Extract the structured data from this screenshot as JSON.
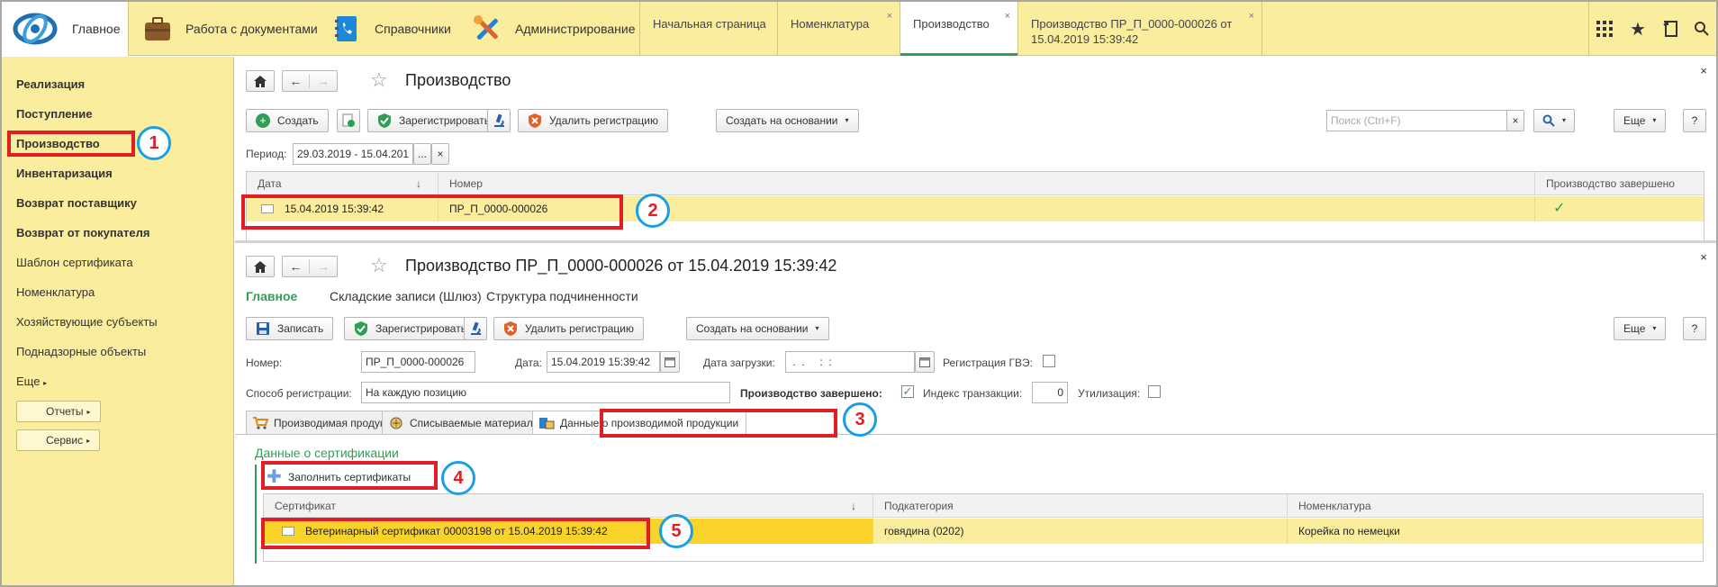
{
  "topbar": {
    "sections": [
      {
        "label": "Главное",
        "icon": "logo-icon"
      },
      {
        "label": "Работа с документами",
        "icon": "briefcase-icon"
      },
      {
        "label": "Справочники",
        "icon": "phonebook-icon"
      },
      {
        "label": "Администрирование",
        "icon": "tools-icon"
      }
    ],
    "tabs": [
      {
        "label": "Начальная страница"
      },
      {
        "label": "Номенклатура",
        "close": "×"
      },
      {
        "label": "Производство",
        "close": "×"
      },
      {
        "label": "Производство ПР_П_0000-000026 от 15.04.2019 15:39:42",
        "close": "×"
      }
    ],
    "right_icons": [
      "apps-grid-icon",
      "star-icon",
      "history-icon",
      "search-icon"
    ]
  },
  "sidebar": {
    "items": [
      {
        "label": "Реализация",
        "bold": true
      },
      {
        "label": "Поступление",
        "bold": true
      },
      {
        "label": "Производство",
        "bold": true
      },
      {
        "label": "Инвентаризация",
        "bold": true
      },
      {
        "label": "Возврат поставщику",
        "bold": true
      },
      {
        "label": "Возврат от покупателя",
        "bold": true
      },
      {
        "label": "Шаблон сертификата",
        "bold": false
      },
      {
        "label": "Номенклатура",
        "bold": false
      },
      {
        "label": "Хозяйствующие субъекты",
        "bold": false
      },
      {
        "label": "Поднадзорные объекты",
        "bold": false
      },
      {
        "label": "Еще",
        "bold": false
      }
    ],
    "reports_label": "Отчеты",
    "service_label": "Сервис"
  },
  "list_form": {
    "title": "Производство",
    "close": "×",
    "toolbar": {
      "create": "Создать",
      "register": "Зарегистрировать",
      "delete_registration": "Удалить регистрацию",
      "create_based_on": "Создать на основании",
      "search_placeholder": "Поиск (Ctrl+F)",
      "search_clear": "×",
      "more": "Еще",
      "help": "?"
    },
    "period_label": "Период:",
    "period_value": "29.03.2019 - 15.04.201",
    "period_pick": "...",
    "period_clear": "×",
    "columns": [
      "Дата",
      "Номер",
      "Производство завершено"
    ],
    "sort_arrow": "↓",
    "rows": [
      {
        "date": "15.04.2019 15:39:42",
        "number": "ПР_П_0000-000026",
        "completed": "✓"
      }
    ]
  },
  "doc_form": {
    "title": "Производство ПР_П_0000-000026 от 15.04.2019 15:39:42",
    "close": "×",
    "nav": [
      "Главное",
      "Складские записи (Шлюз)",
      "Структура подчиненности"
    ],
    "toolbar": {
      "save": "Записать",
      "register": "Зарегистрировать",
      "delete_registration": "Удалить регистрацию",
      "create_based_on": "Создать на основании",
      "more": "Еще",
      "help": "?"
    },
    "fields": {
      "number_label": "Номер:",
      "number_value": "ПР_П_0000-000026",
      "date_label": "Дата:",
      "date_value": "15.04.2019 15:39:42",
      "load_date_label": "Дата загрузки:",
      "load_date_value": " .  .     :  :",
      "gve_label": "Регистрация ГВЭ:",
      "reg_method_label": "Способ регистрации:",
      "reg_method_value": "На каждую позицию",
      "completed_label": "Производство завершено:",
      "completed_check": "✓",
      "tx_index_label": "Индекс транзакции:",
      "tx_index_value": "0",
      "utilization_label": "Утилизация:"
    },
    "tabs": [
      {
        "label": "Производимая продукция"
      },
      {
        "label": "Списываемые материалы"
      },
      {
        "label": "Данные о производимой продукции"
      }
    ],
    "group_title": "Данные о сертификации",
    "fill_certificates": "Заполнить сертификаты",
    "cert_columns": [
      "Сертификат",
      "Подкатегория",
      "Номенклатура"
    ],
    "cert_rows": [
      {
        "certificate": "Ветеринарный сертификат 00003198 от 15.04.2019 15:39:42",
        "subcategory": "говядина (0202)",
        "nomenclature": "Корейка по немецки"
      }
    ]
  },
  "annotations": [
    "1",
    "2",
    "3",
    "4",
    "5"
  ]
}
